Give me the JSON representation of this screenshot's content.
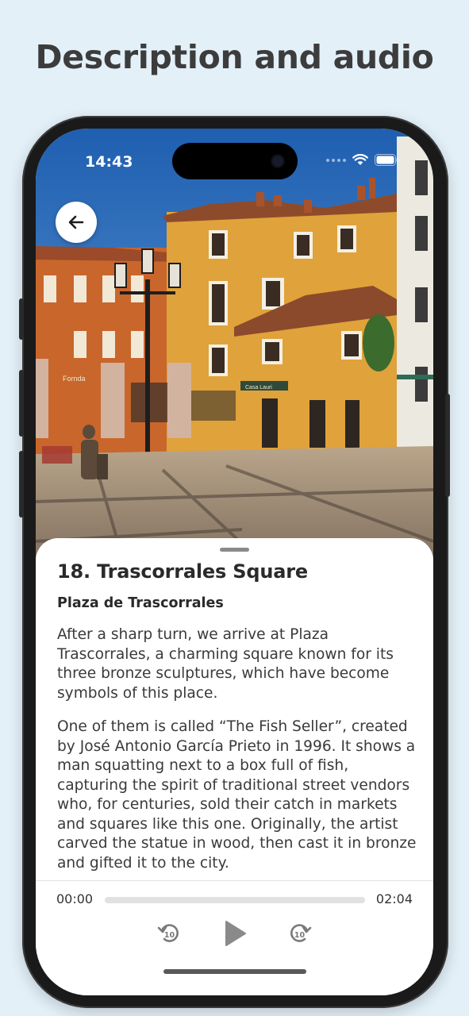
{
  "headline": "Description and audio",
  "status_bar": {
    "time": "14:43"
  },
  "sheet": {
    "title": "18. Trascorrales Square",
    "subtitle": "Plaza de Trascorrales",
    "paragraphs": [
      "After a sharp turn, we arrive at Plaza Trascorrales, a charming square known for its three bronze sculptures, which have become symbols of this place.",
      "One of them is called “The Fish Seller”, created by José Antonio García Prieto in 1996. It shows a man squatting next to a box full of fish, capturing the spirit of traditional street vendors who, for centuries, sold their catch in markets and squares like this one. Originally, the artist carved the statue in wood, then cast it in bronze and gifted it to the city."
    ]
  },
  "player": {
    "current_time": "00:00",
    "duration": "02:04",
    "progress": 0,
    "rewind_label": "10",
    "forward_label": "10"
  },
  "photo_signs": {
    "cafe": "Fornda",
    "shop": "Casa Lauri"
  },
  "icons": {
    "back": "arrow-left-icon",
    "rewind": "rewind-10-icon",
    "play": "play-icon",
    "forward": "forward-10-icon",
    "wifi": "wifi-icon",
    "battery": "battery-icon"
  }
}
